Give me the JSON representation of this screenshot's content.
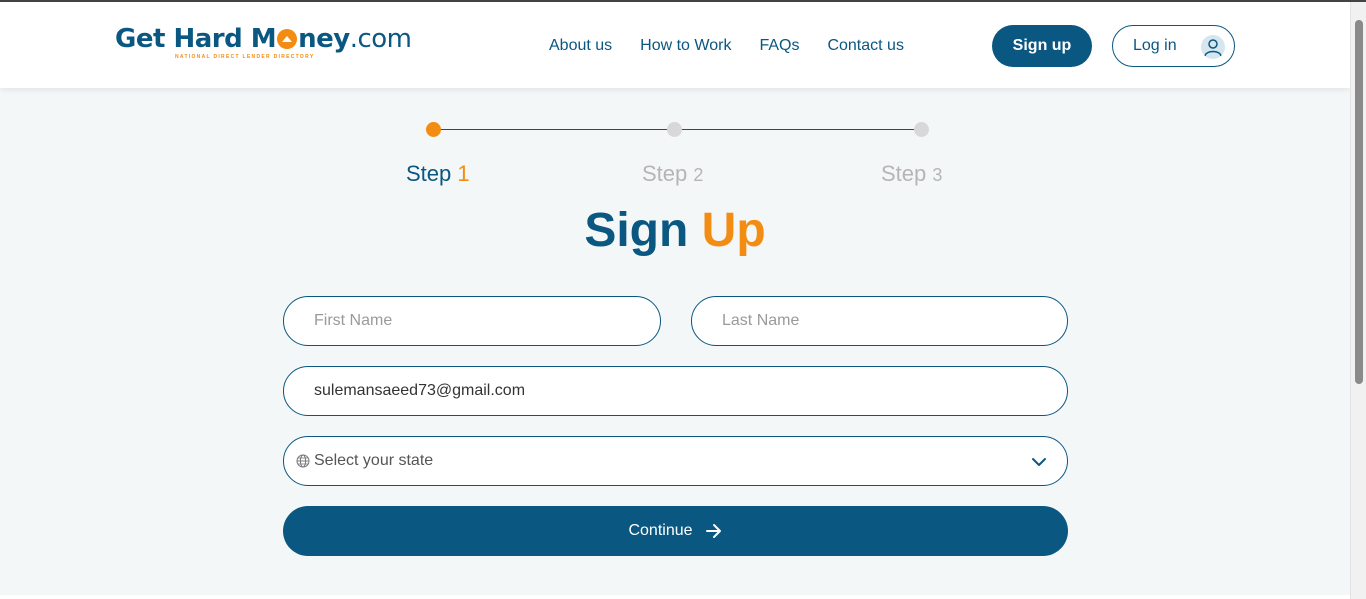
{
  "header": {
    "logo": {
      "text_part1": "Get Hard M",
      "text_part2": "ney",
      "text_part3": ".com",
      "tagline": "NATIONAL DIRECT LENDER DIRECTORY"
    },
    "nav": [
      "About us",
      "How to Work",
      "FAQs",
      "Contact us"
    ],
    "signup_label": "Sign up",
    "login_label": "Log in"
  },
  "progress": {
    "steps": [
      {
        "word": "Step",
        "num": "1",
        "active": true
      },
      {
        "word": "Step",
        "num": "2",
        "active": false
      },
      {
        "word": "Step",
        "num": "3",
        "active": false
      }
    ]
  },
  "form": {
    "title_part1": "Sign",
    "title_part2": "Up",
    "first_name_placeholder": "First Name",
    "last_name_placeholder": "Last Name",
    "email_value": "sulemansaeed73@gmail.com",
    "state_placeholder": "Select your state",
    "continue_label": "Continue"
  },
  "colors": {
    "primary": "#0a5781",
    "accent": "#f28c13",
    "inactive": "#d8d8d8"
  },
  "icons": {
    "avatar": "user-avatar-icon",
    "globe": "globe-icon",
    "chevron": "chevron-down-icon",
    "arrow": "arrow-right-icon"
  }
}
